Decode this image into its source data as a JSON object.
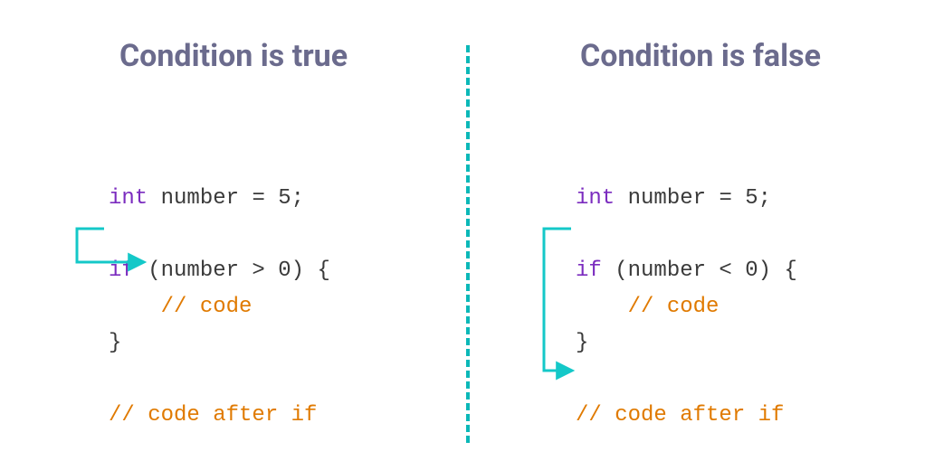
{
  "left": {
    "title": "Condition is true",
    "code": {
      "l1a": "int",
      "l1b": " number = 5;",
      "l2a": "if",
      "l2b": " (number > 0) {",
      "l3": "    // code",
      "l4": "}",
      "l5": "// code after if"
    }
  },
  "right": {
    "title": "Condition is false",
    "code": {
      "l1a": "int",
      "l1b": " number = 5;",
      "l2a": "if",
      "l2b": " (number < 0) {",
      "l3": "    // code",
      "l4": "}",
      "l5": "// code after if"
    }
  },
  "colors": {
    "arrow": "#14c8c8"
  }
}
